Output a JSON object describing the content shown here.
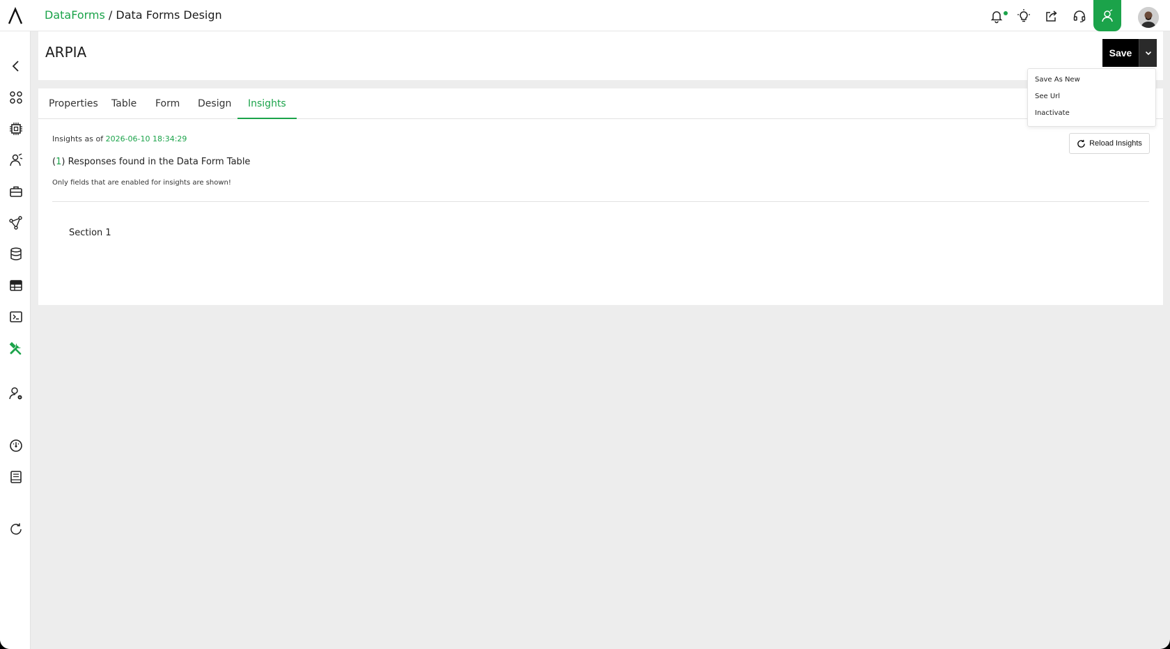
{
  "topbar": {
    "breadcrumb_link": "DataForms",
    "breadcrumb_separator": " / ",
    "breadcrumb_current": "Data Forms Design",
    "accent_color": "#1ba34a",
    "icons": [
      "bell-icon",
      "lightbulb-icon",
      "share-icon",
      "headset-icon",
      "admin-user-icon",
      "avatar"
    ]
  },
  "sidebar": {
    "items": [
      "back-chevron-icon",
      "apps-grid-icon",
      "chip-icon",
      "network-user-icon",
      "briefcase-icon",
      "graph-nodes-icon",
      "database-icon",
      "table-icon",
      "terminal-icon",
      "tools-icon",
      "user-settings-icon",
      "dashboard-gauge-icon",
      "book-icon",
      "refresh-icon"
    ],
    "active_item": "tools-icon"
  },
  "header": {
    "title": "ARPIA",
    "save_label": "Save"
  },
  "dropdown": {
    "items": [
      "Save As New",
      "See Url",
      "Inactivate"
    ]
  },
  "tabs": [
    {
      "label": "Properties"
    },
    {
      "label": "Table"
    },
    {
      "label": "Form"
    },
    {
      "label": "Design"
    },
    {
      "label": "Insights",
      "active": true
    }
  ],
  "insights": {
    "as_of_prefix": "Insights as of ",
    "timestamp": "2026-06-10 18:34:29",
    "count_open": "(",
    "count": "1",
    "count_close": ")",
    "responses_text": " Responses found in the Data Form Table",
    "note": "Only fields that are enabled for insights are shown!",
    "reload_label": "Reload Insights",
    "section_label": "Section 1"
  }
}
